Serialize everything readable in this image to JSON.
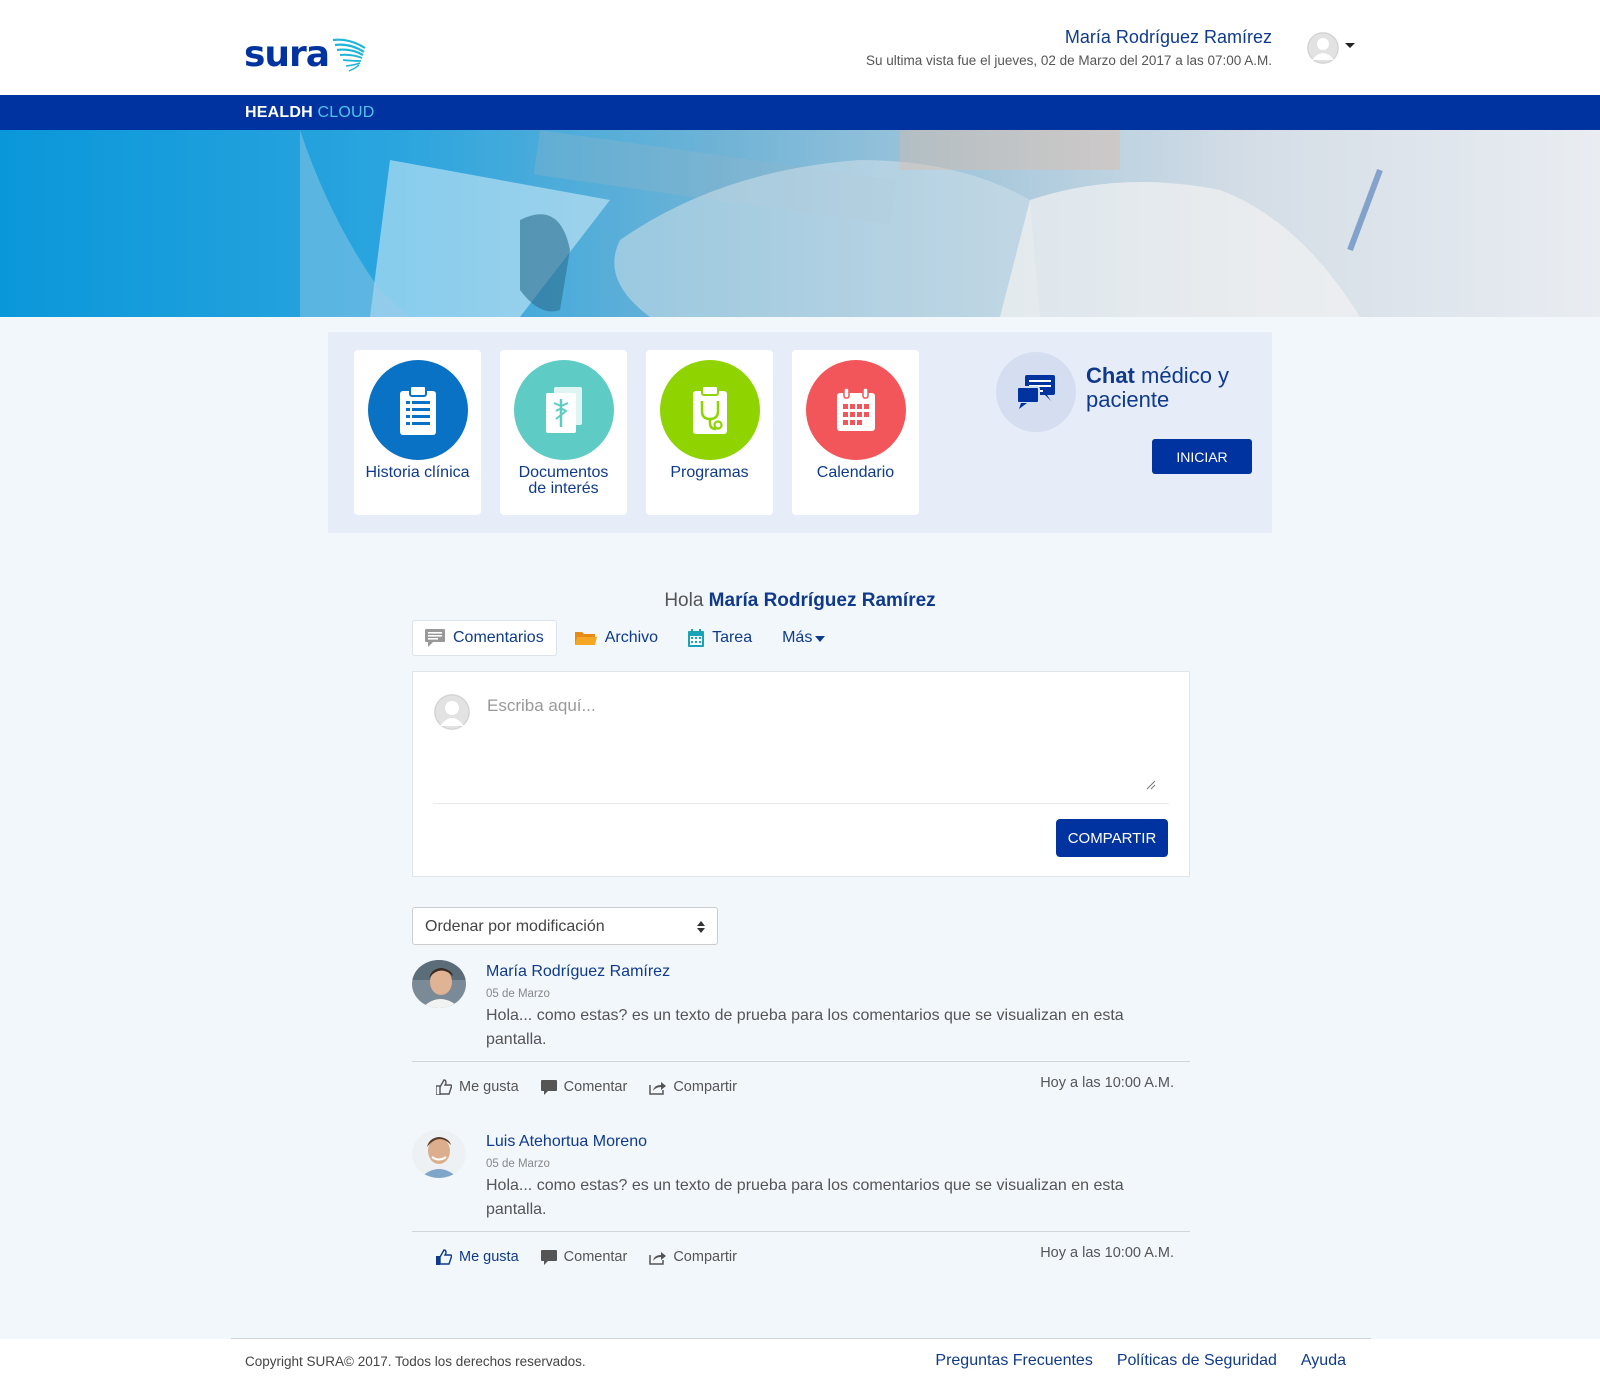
{
  "header": {
    "logo_text": "sura",
    "user_name": "María Rodríguez Ramírez",
    "last_visit": "Su ultima vista fue el jueves, 02 de Marzo del 2017 a las 07:00 A.M."
  },
  "navbar": {
    "brand_main": "HEALDH",
    "brand_accent": "CLOUD"
  },
  "quick_access": {
    "tiles": [
      {
        "label": "Historia clínica",
        "icon": "clipboard-icon",
        "color": "#0a72c4"
      },
      {
        "label": "Documentos de interés",
        "icon": "medical-documents-icon",
        "color": "#5ecbc5"
      },
      {
        "label": "Programas",
        "icon": "stethoscope-clipboard-icon",
        "color": "#8fd400"
      },
      {
        "label": "Calendario",
        "icon": "calendar-icon",
        "color": "#f2565a"
      }
    ],
    "chat": {
      "title_bold": "Chat",
      "title_rest": " médico y paciente",
      "button": "INICIAR"
    }
  },
  "feed": {
    "greeting_prefix": "Hola ",
    "greeting_name": "María Rodríguez Ramírez",
    "tabs": [
      {
        "label": "Comentarios",
        "icon": "comment-icon"
      },
      {
        "label": "Archivo",
        "icon": "folder-icon"
      },
      {
        "label": "Tarea",
        "icon": "calendar-icon"
      },
      {
        "label": "Más",
        "icon": "chevron-down-icon"
      }
    ],
    "composer": {
      "placeholder": "Escriba aquí...",
      "share_button": "COMPARTIR"
    },
    "sort": {
      "selected": "Ordenar por modificación"
    },
    "posts": [
      {
        "author": "María Rodríguez Ramírez",
        "date": "05 de Marzo",
        "text": "Hola... como estas? es un texto de prueba para los comentarios que se visualizan en esta pantalla.",
        "actions": {
          "like": "Me gusta",
          "comment": "Comentar",
          "share": "Compartir"
        },
        "time": "Hoy a las 10:00 A.M.",
        "liked": false
      },
      {
        "author": "Luis Atehortua Moreno",
        "date": "05 de Marzo",
        "text": "Hola... como estas? es un texto de prueba para los comentarios que se visualizan en esta pantalla.",
        "actions": {
          "like": "Me gusta",
          "comment": "Comentar",
          "share": "Compartir"
        },
        "time": "Hoy a las 10:00 A.M.",
        "liked": true
      }
    ]
  },
  "footer": {
    "copyright": "Copyright SURA© 2017. Todos los derechos reservados.",
    "links": [
      "Preguntas Frecuentes",
      "Políticas de Seguridad",
      "Ayuda"
    ]
  },
  "colors": {
    "primary": "#0033a0",
    "accent_cloud": "#4fc3ee",
    "page_bg": "#f2f7fc"
  }
}
